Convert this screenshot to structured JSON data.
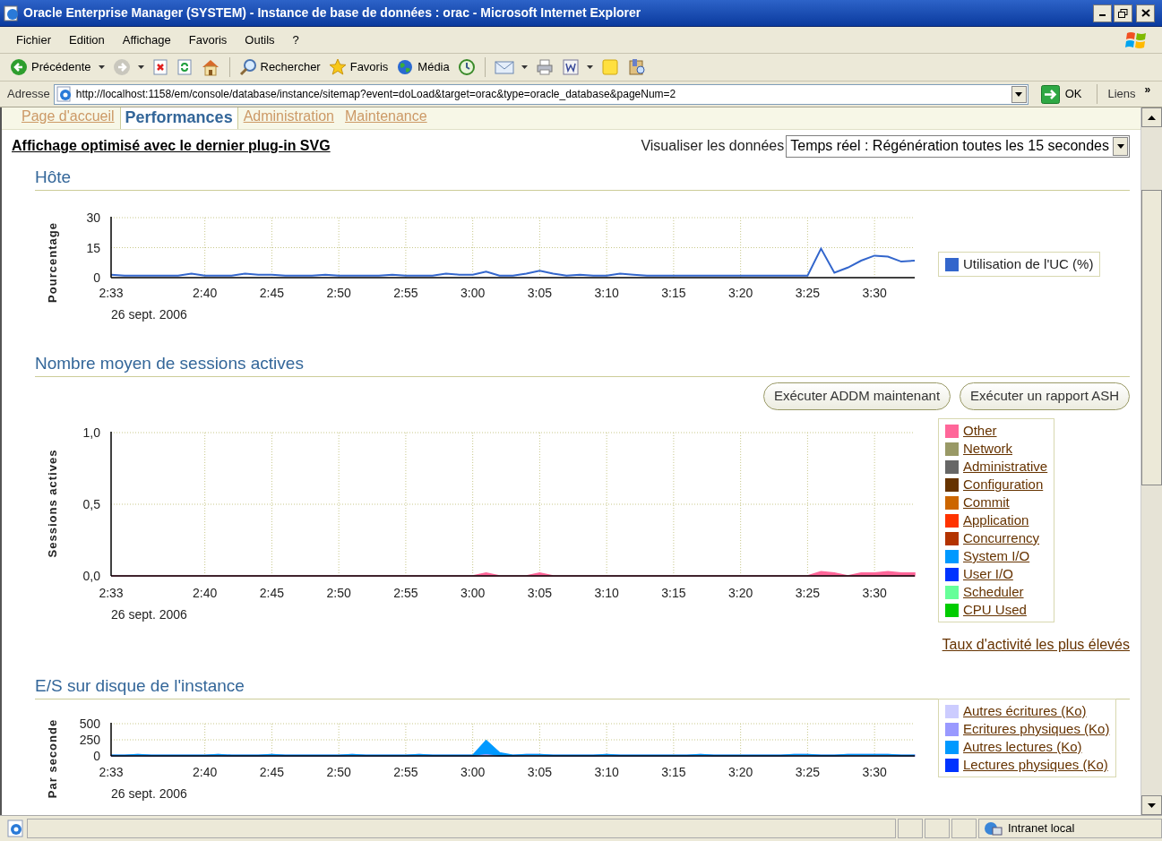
{
  "window": {
    "title": "Oracle Enterprise Manager (SYSTEM) - Instance de base de données : orac - Microsoft Internet Explorer"
  },
  "menu_bar": [
    "Fichier",
    "Edition",
    "Affichage",
    "Favoris",
    "Outils",
    "?"
  ],
  "toolbar": [
    {
      "kind": "back",
      "label": "Précédente",
      "dropdown": true
    },
    {
      "kind": "forward",
      "dropdown": true
    },
    {
      "kind": "stop",
      "dropdown": false
    },
    {
      "kind": "refresh",
      "dropdown": false
    },
    {
      "kind": "home",
      "dropdown": false
    },
    {
      "kind": "separator"
    },
    {
      "kind": "search",
      "label": "Rechercher",
      "dropdown": false
    },
    {
      "kind": "favorites",
      "label": "Favoris",
      "dropdown": false
    },
    {
      "kind": "media",
      "label": "Média",
      "dropdown": false
    },
    {
      "kind": "history",
      "dropdown": false
    },
    {
      "kind": "separator"
    },
    {
      "kind": "mail",
      "dropdown": true
    },
    {
      "kind": "print",
      "dropdown": false
    },
    {
      "kind": "edit",
      "dropdown": true
    },
    {
      "kind": "note",
      "dropdown": false
    },
    {
      "kind": "research",
      "dropdown": false
    }
  ],
  "address_bar": {
    "label": "Adresse",
    "url": "http://localhost:1158/em/console/database/instance/sitemap?event=doLoad&target=orac&type=oracle_database&pageNum=2",
    "go": "OK",
    "links": "Liens",
    "links_more": "»"
  },
  "tabs": [
    {
      "label": "Page d'accueil",
      "selected": false
    },
    {
      "label": "Performances",
      "selected": true
    },
    {
      "label": "Administration",
      "selected": false
    },
    {
      "label": "Maintenance",
      "selected": false
    }
  ],
  "page": {
    "svg_notice": "Affichage optimisé avec le dernier plug-in SVG",
    "view_label": "Visualiser les données",
    "view_select": "Temps réel : Régénération toutes les 15 secondes"
  },
  "sections": [
    {
      "title": "Hôte",
      "legend_links": false,
      "chart_data": {
        "type": "line",
        "grid": true,
        "xlabel": "26 sept. 2006",
        "ylabel": "Pourcentage",
        "ylim": [
          0,
          30
        ],
        "yticks": [
          0,
          15,
          30
        ],
        "categories": [
          "2:33",
          null,
          null,
          null,
          null,
          null,
          null,
          "2:40",
          null,
          null,
          null,
          null,
          "2:45",
          null,
          null,
          null,
          null,
          "2:50",
          null,
          null,
          null,
          null,
          "2:55",
          null,
          null,
          null,
          null,
          "3:00",
          null,
          null,
          null,
          null,
          "3:05",
          null,
          null,
          null,
          null,
          "3:10",
          null,
          null,
          null,
          null,
          "3:15",
          null,
          null,
          null,
          null,
          "3:20",
          null,
          null,
          null,
          null,
          "3:25",
          null,
          null,
          null,
          null,
          "3:30",
          null,
          null,
          null
        ],
        "series": [
          {
            "name": "Utilisation de l'UC (%)",
            "color": "#3366cc",
            "values": [
              1.5,
              1,
              1,
              1,
              1,
              1,
              2,
              1,
              1,
              1,
              2,
              1.5,
              1.5,
              1,
              1,
              1,
              1.5,
              1,
              1,
              1,
              1,
              1.5,
              1,
              1,
              1,
              2,
              1.5,
              1.5,
              3,
              1,
              1,
              2,
              3.5,
              2,
              1,
              1.5,
              1,
              1,
              2,
              1.5,
              1,
              1,
              1,
              1,
              1,
              1,
              1,
              1,
              1,
              1,
              1,
              1,
              1,
              14.5,
              2.5,
              5,
              8.5,
              11,
              10.5,
              8,
              8.5
            ]
          }
        ]
      }
    },
    {
      "title": "Nombre moyen de sessions actives",
      "buttons": [
        "Exécuter ADDM maintenant",
        "Exécuter un rapport ASH"
      ],
      "link": "Taux d'activité les plus élevés",
      "legend_links": true,
      "chart_data": {
        "type": "area",
        "grid": true,
        "xlabel": "26 sept. 2006",
        "ylabel": "Sessions actives",
        "ylim": [
          0,
          1
        ],
        "yticks": [
          {
            "value": 0,
            "label": "0,0"
          },
          {
            "value": 0.5,
            "label": "0,5"
          },
          {
            "value": 1,
            "label": "1,0"
          }
        ],
        "categories": [
          "2:33",
          null,
          null,
          null,
          null,
          null,
          null,
          "2:40",
          null,
          null,
          null,
          null,
          "2:45",
          null,
          null,
          null,
          null,
          "2:50",
          null,
          null,
          null,
          null,
          "2:55",
          null,
          null,
          null,
          null,
          "3:00",
          null,
          null,
          null,
          null,
          "3:05",
          null,
          null,
          null,
          null,
          "3:10",
          null,
          null,
          null,
          null,
          "3:15",
          null,
          null,
          null,
          null,
          "3:20",
          null,
          null,
          null,
          null,
          "3:25",
          null,
          null,
          null,
          null,
          "3:30",
          null,
          null,
          null
        ],
        "series": [
          {
            "name": "Other",
            "color": "#ff6699",
            "values": [
              0,
              0,
              0,
              0,
              0,
              0,
              0,
              0,
              0,
              0,
              0,
              0,
              0,
              0,
              0,
              0,
              0,
              0,
              0,
              0,
              0,
              0,
              0,
              0,
              0,
              0,
              0,
              0,
              0.02,
              0,
              0,
              0,
              0.02,
              0,
              0,
              0,
              0,
              0,
              0,
              0,
              0,
              0,
              0,
              0,
              0,
              0,
              0,
              0,
              0,
              0,
              0,
              0,
              0,
              0.03,
              0.02,
              0,
              0.02,
              0.02,
              0.03,
              0.02,
              0.02
            ]
          }
        ]
      },
      "legend": [
        {
          "kind": "series"
        },
        {
          "label": "Network",
          "color": "#999966"
        },
        {
          "label": "Administrative",
          "color": "#666666"
        },
        {
          "label": "Configuration",
          "color": "#663300"
        },
        {
          "label": "Commit",
          "color": "#cc6600"
        },
        {
          "label": "Application",
          "color": "#ff3300"
        },
        {
          "label": "Concurrency",
          "color": "#b33300"
        },
        {
          "label": "System I/O",
          "color": "#0099ff"
        },
        {
          "label": "User I/O",
          "color": "#0033ff"
        },
        {
          "label": "Scheduler",
          "color": "#66ff99"
        },
        {
          "label": "CPU Used",
          "color": "#00cc00"
        }
      ]
    },
    {
      "title": "E/S sur disque de l'instance",
      "legend_links": true,
      "chart_data": {
        "type": "area",
        "stacked": true,
        "grid": true,
        "xlabel": "26 sept. 2006",
        "ylabel": "Par seconde",
        "ylim": [
          0,
          500
        ],
        "yticks": [
          0,
          250,
          500
        ],
        "categories": [
          "2:33",
          null,
          null,
          null,
          null,
          null,
          null,
          "2:40",
          null,
          null,
          null,
          null,
          "2:45",
          null,
          null,
          null,
          null,
          "2:50",
          null,
          null,
          null,
          null,
          "2:55",
          null,
          null,
          null,
          null,
          "3:00",
          null,
          null,
          null,
          null,
          "3:05",
          null,
          null,
          null,
          null,
          "3:10",
          null,
          null,
          null,
          null,
          "3:15",
          null,
          null,
          null,
          null,
          "3:20",
          null,
          null,
          null,
          null,
          "3:25",
          null,
          null,
          null,
          null,
          "3:30",
          null,
          null,
          null
        ],
        "series": [
          {
            "name": "Autres écritures (Ko)",
            "color": "#ccccff",
            "values": [
              0,
              0,
              10,
              0,
              0,
              0,
              0,
              0,
              10,
              0,
              0,
              0,
              10,
              0,
              0,
              0,
              0,
              0,
              10,
              0,
              0,
              0,
              0,
              10,
              0,
              0,
              0,
              0,
              20,
              0,
              0,
              10,
              10,
              0,
              0,
              0,
              0,
              10,
              0,
              0,
              0,
              0,
              0,
              0,
              10,
              0,
              0,
              0,
              0,
              0,
              0,
              10,
              10,
              0,
              0,
              10,
              10,
              10,
              10,
              0,
              0
            ]
          },
          {
            "name": "Ecritures physiques (Ko)",
            "color": "#9999ff",
            "values": [
              10,
              10,
              10,
              10,
              10,
              10,
              10,
              10,
              10,
              10,
              10,
              10,
              10,
              10,
              10,
              10,
              10,
              10,
              10,
              10,
              10,
              10,
              10,
              10,
              10,
              10,
              10,
              10,
              20,
              10,
              10,
              10,
              10,
              10,
              10,
              10,
              10,
              10,
              10,
              10,
              10,
              10,
              10,
              10,
              10,
              10,
              10,
              10,
              10,
              10,
              10,
              10,
              10,
              10,
              10,
              10,
              10,
              10,
              10,
              10,
              10
            ]
          },
          {
            "name": "Autres lectures (Ko)",
            "color": "#0099ff",
            "values": [
              0,
              0,
              0,
              0,
              0,
              0,
              0,
              0,
              0,
              0,
              0,
              0,
              0,
              0,
              0,
              0,
              0,
              0,
              0,
              0,
              0,
              0,
              0,
              0,
              0,
              0,
              0,
              0,
              200,
              40,
              0,
              0,
              0,
              0,
              0,
              0,
              0,
              0,
              0,
              0,
              0,
              0,
              0,
              0,
              0,
              0,
              0,
              0,
              0,
              0,
              0,
              0,
              0,
              0,
              0,
              0,
              0,
              0,
              0,
              0,
              0
            ]
          }
        ]
      },
      "legend": [
        {
          "kind": "series"
        },
        {
          "kind": "series"
        },
        {
          "kind": "series"
        },
        {
          "label": "Lectures physiques (Ko)",
          "color": "#0033ff"
        }
      ]
    }
  ],
  "status_bar": {
    "zone": "Intranet local"
  }
}
